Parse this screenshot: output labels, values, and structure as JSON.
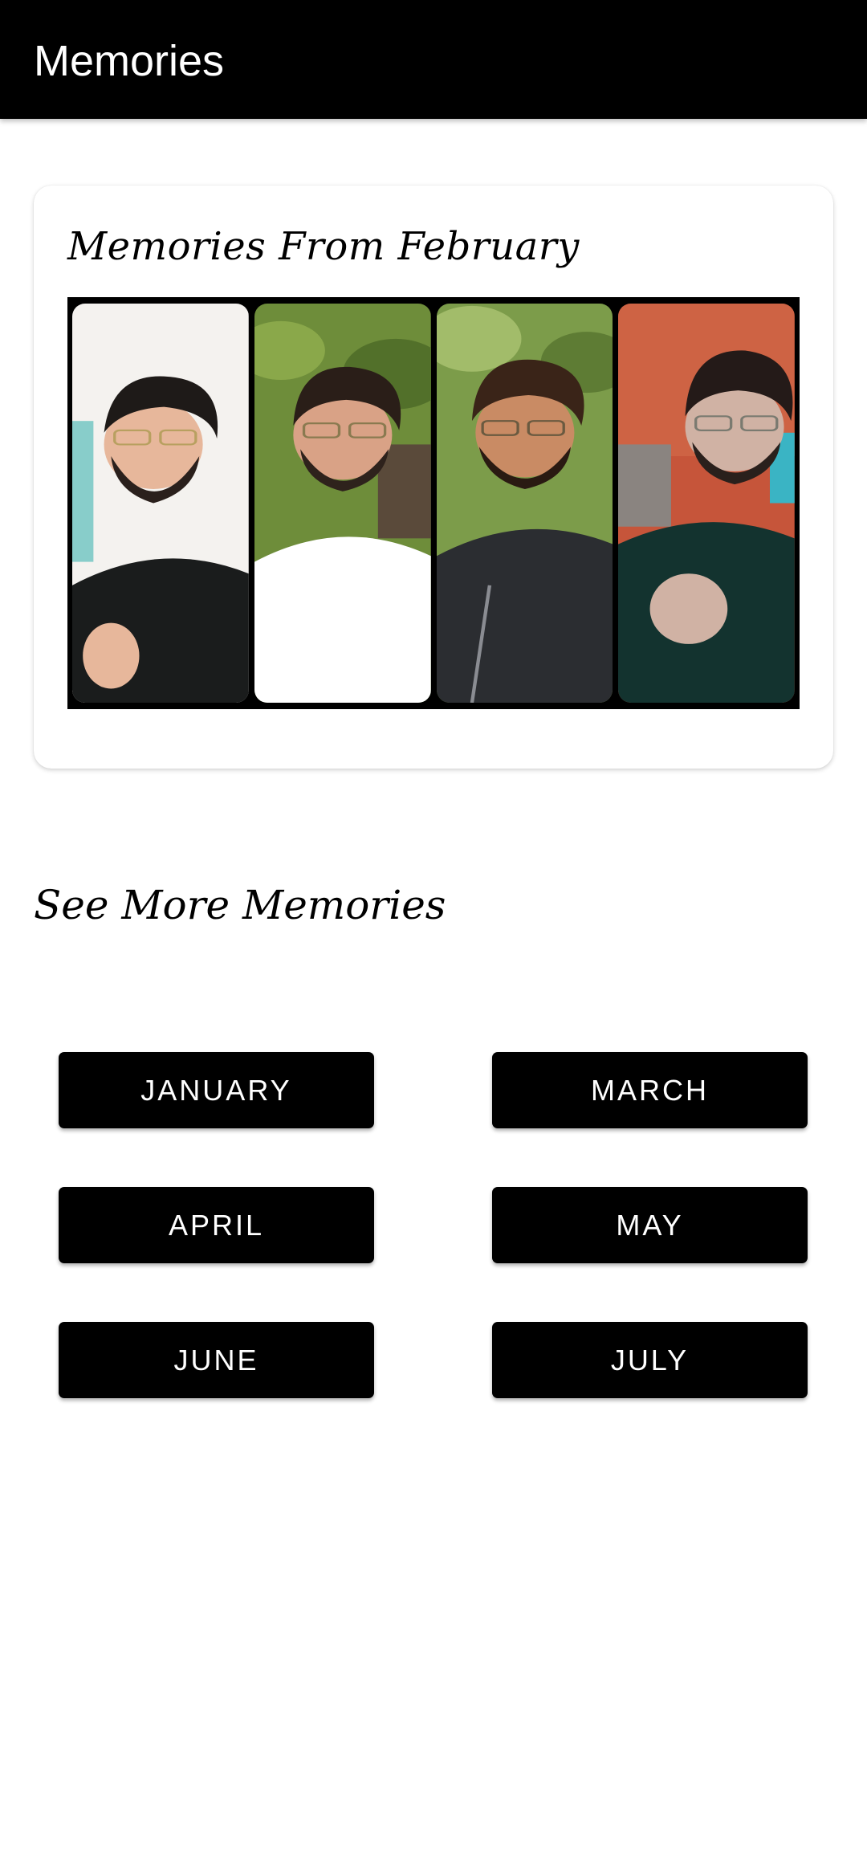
{
  "app_bar": {
    "title": "Memories"
  },
  "featured": {
    "heading": "Memories From February",
    "photos": [
      {
        "name": "photo-1",
        "background": "#f4f2ef",
        "shirt": "#1a1c1c",
        "skin": "#e7b79b"
      },
      {
        "name": "photo-2",
        "background": "#6e8d3a",
        "shirt": "#ffffff",
        "skin": "#d9a286"
      },
      {
        "name": "photo-3",
        "background": "#7c9c4a",
        "shirt": "#2b2d31",
        "skin": "#c98b64"
      },
      {
        "name": "photo-4",
        "background": "#c6553a",
        "shirt": "#13332f",
        "skin": "#d0b2a4"
      }
    ]
  },
  "more": {
    "heading": "See More Memories",
    "buttons": [
      {
        "label": "JANUARY"
      },
      {
        "label": "MARCH"
      },
      {
        "label": "APRIL"
      },
      {
        "label": "MAY"
      },
      {
        "label": "JUNE"
      },
      {
        "label": "JULY"
      }
    ]
  },
  "colors": {
    "app_bar": "#000000",
    "button": "#000000",
    "button_text": "#ffffff",
    "background": "#ffffff"
  }
}
